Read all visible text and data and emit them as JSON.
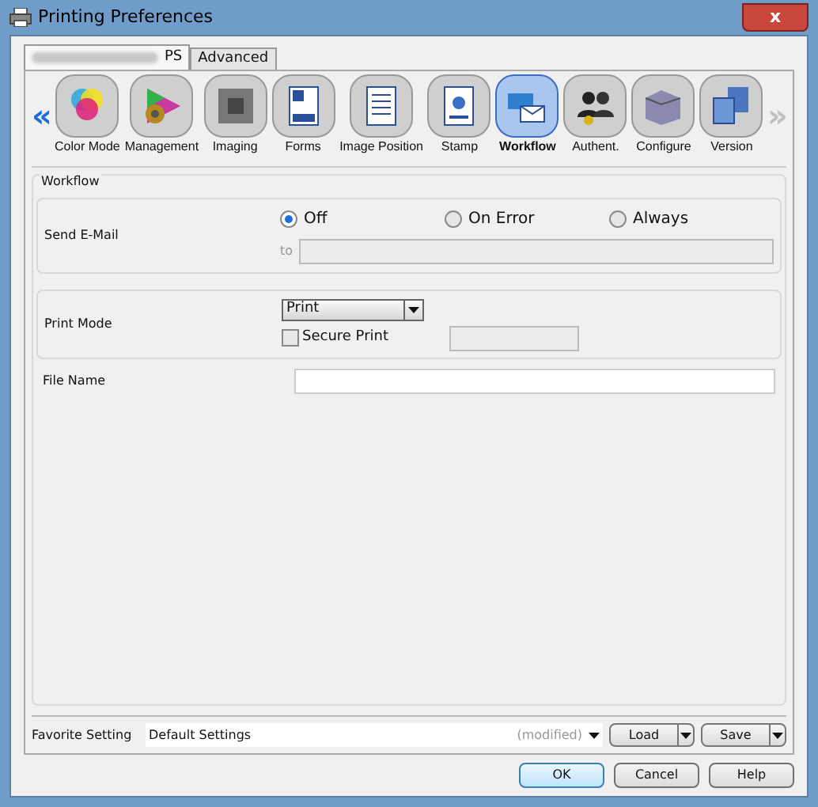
{
  "window": {
    "title": "Printing Preferences",
    "close": "x"
  },
  "tabs": [
    {
      "label": "PS",
      "selected": true
    },
    {
      "label": "Advanced",
      "selected": false
    }
  ],
  "nav": {
    "prev": "«",
    "next": "»"
  },
  "categories": [
    {
      "label": "Color Mode",
      "selected": false
    },
    {
      "label": "Management",
      "selected": false
    },
    {
      "label": "Imaging",
      "selected": false
    },
    {
      "label": "Forms",
      "selected": false
    },
    {
      "label": "Image Position",
      "selected": false
    },
    {
      "label": "Stamp",
      "selected": false
    },
    {
      "label": "Workflow",
      "selected": true
    },
    {
      "label": "Authent.",
      "selected": false
    },
    {
      "label": "Configure",
      "selected": false
    },
    {
      "label": "Version",
      "selected": false
    }
  ],
  "section": {
    "title": "Workflow"
  },
  "send_email": {
    "label": "Send E-Mail",
    "options": [
      {
        "label": "Off",
        "selected": true
      },
      {
        "label": "On Error",
        "selected": false
      },
      {
        "label": "Always",
        "selected": false
      }
    ],
    "to_label": "to"
  },
  "print_mode": {
    "label": "Print Mode",
    "value": "Print",
    "secure_print": {
      "label": "Secure Print",
      "checked": false
    }
  },
  "file_name": {
    "label": "File Name"
  },
  "favorite": {
    "label": "Favorite Setting",
    "value": "Default Settings",
    "status": "(modified)",
    "load": "Load",
    "save": "Save"
  },
  "buttons": [
    {
      "label": "OK",
      "default": true
    },
    {
      "label": "Cancel",
      "default": false
    },
    {
      "label": "Help",
      "default": false
    }
  ]
}
